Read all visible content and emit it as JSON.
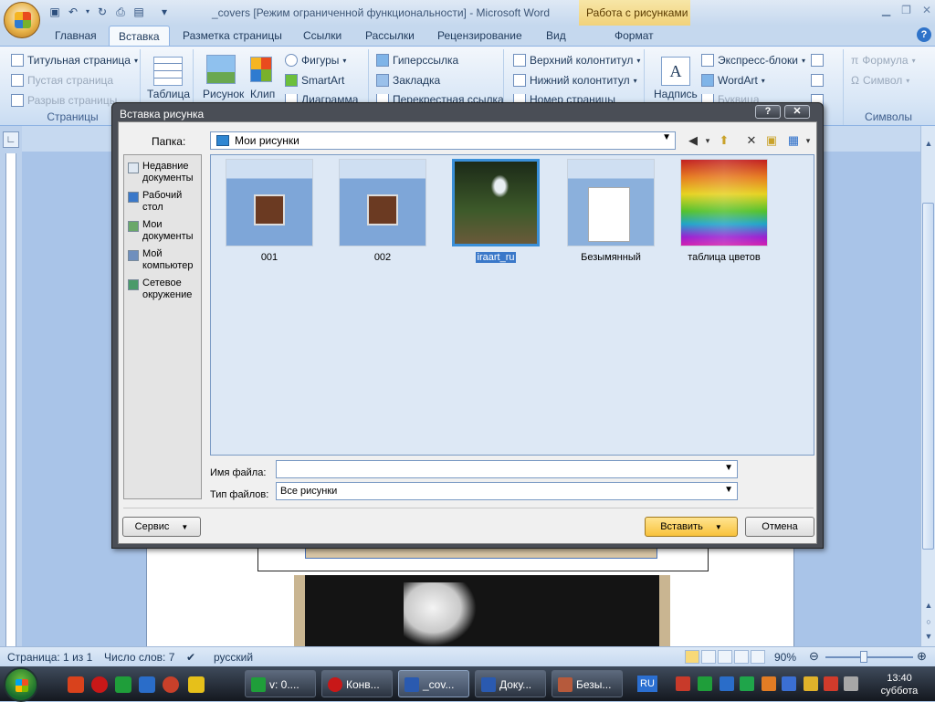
{
  "window": {
    "title": "_covers [Режим ограниченной функциональности] - Microsoft Word",
    "context_tab": "Работа с рисунками"
  },
  "ribbon_tabs": [
    "Главная",
    "Вставка",
    "Разметка страницы",
    "Ссылки",
    "Рассылки",
    "Рецензирование",
    "Вид",
    "Формат"
  ],
  "ribbon": {
    "pages": {
      "items": [
        "Титульная страница",
        "Пустая страница",
        "Разрыв страницы"
      ],
      "label": "Страницы"
    },
    "table_label": "Таблица",
    "picture_label": "Рисунок",
    "clip_label": "Клип",
    "shapes_label": "Фигуры",
    "smartart_label": "SmartArt",
    "diagram_label": "Диаграмма",
    "hyperlink_label": "Гиперссылка",
    "bookmark_label": "Закладка",
    "crossref_label": "Перекрестная ссылка",
    "header_label": "Верхний колонтитул",
    "footer_label": "Нижний колонтитул",
    "pagenum_label": "Номер страницы",
    "textbox_label": "Надпись",
    "quickparts_label": "Экспресс-блоки",
    "wordart_label": "WordArt",
    "dropcap_label": "Буквица",
    "formula_label": "Формула",
    "symbol_label": "Символ",
    "symbols_group_label": "Символы"
  },
  "dialog": {
    "title": "Вставка рисунка",
    "folder_label": "Папка:",
    "folder_value": "Мои рисунки",
    "places": [
      {
        "label": "Недавние документы",
        "icon": "recent-docs-icon"
      },
      {
        "label": "Рабочий стол",
        "icon": "desktop-icon"
      },
      {
        "label": "Мои документы",
        "icon": "my-docs-icon"
      },
      {
        "label": "Мой компьютер",
        "icon": "my-computer-icon"
      },
      {
        "label": "Сетевое окружение",
        "icon": "network-icon"
      }
    ],
    "files": [
      {
        "name": "001",
        "selected": false
      },
      {
        "name": "002",
        "selected": false
      },
      {
        "name": "iraart_ru",
        "selected": true
      },
      {
        "name": "Безымянный",
        "selected": false
      },
      {
        "name": "таблица цветов",
        "selected": false
      }
    ],
    "filename_label": "Имя файла:",
    "filename_value": "",
    "filetype_label": "Тип файлов:",
    "filetype_value": "Все рисунки",
    "service_button": "Сервис",
    "insert_button": "Вставить",
    "cancel_button": "Отмена"
  },
  "statusbar": {
    "page": "Страница: 1 из 1",
    "words": "Число слов: 7",
    "language": "русский",
    "zoom": "90%"
  },
  "taskbar": {
    "tasks": [
      "v: 0....",
      "Конв...",
      "_cov...",
      "Доку...",
      "Безы..."
    ],
    "lang": "RU",
    "time": "13:40",
    "day": "суббота"
  },
  "colors": {
    "accent": "#3a78c9",
    "context_tab": "#f1d27a",
    "insert_button": "#f8c23c"
  }
}
